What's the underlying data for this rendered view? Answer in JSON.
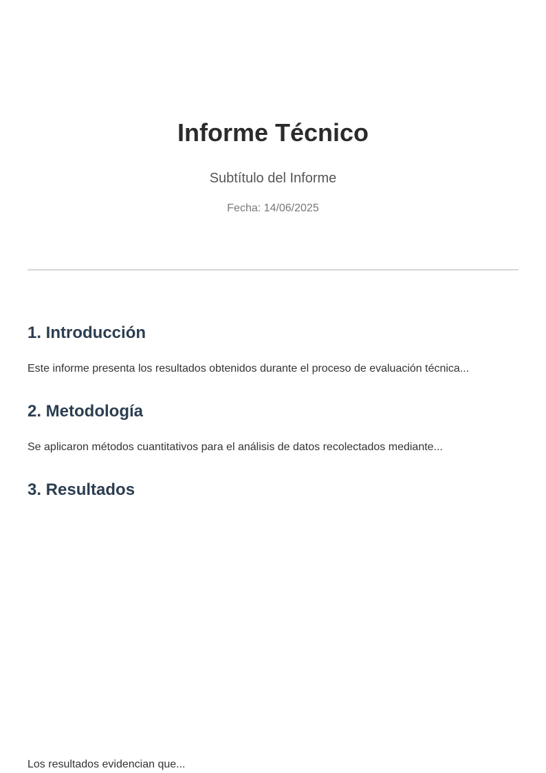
{
  "cover": {
    "title": "Informe Técnico",
    "subtitle": "Subtítulo del Informe",
    "date": "Fecha: 14/06/2025"
  },
  "sections": [
    {
      "heading": "1. Introducción",
      "body": "Este informe presenta los resultados obtenidos durante el proceso de evaluación técnica..."
    },
    {
      "heading": "2. Metodología",
      "body": "Se aplicaron métodos cuantitativos para el análisis de datos recolectados mediante..."
    },
    {
      "heading": "3. Resultados",
      "body": "Los resultados evidencian que..."
    }
  ],
  "colors": {
    "heading": "#2c3e50",
    "title": "#2b2b2b",
    "divider": "#d6d6d6"
  }
}
